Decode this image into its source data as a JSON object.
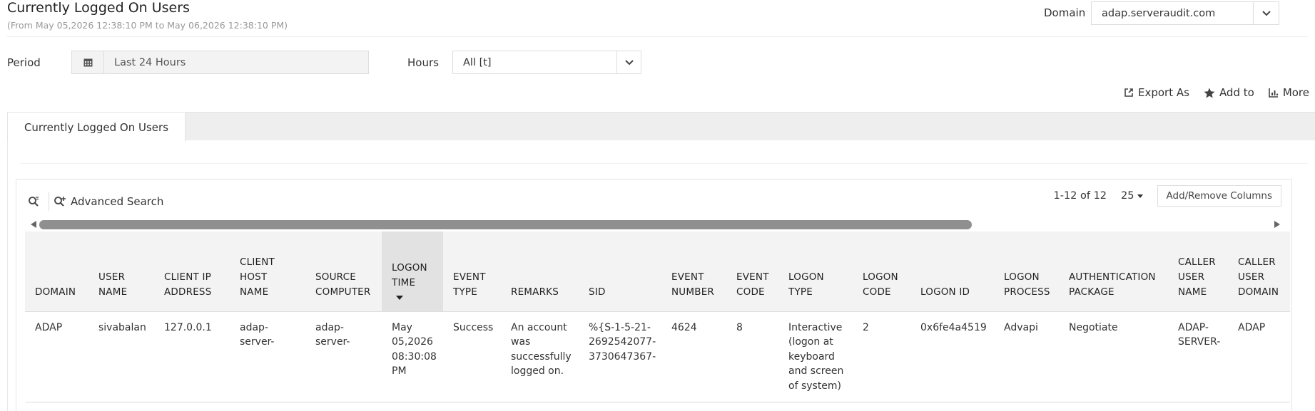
{
  "header": {
    "title": "Currently Logged On Users",
    "date_range": "(From May 05,2026 12:38:10 PM to May 06,2026 12:38:10 PM)",
    "domain_label": "Domain",
    "domain_value": "adap.serveraudit.com"
  },
  "filters": {
    "period_label": "Period",
    "period_value": "Last 24 Hours",
    "hours_label": "Hours",
    "hours_value": "All [t]"
  },
  "actions": {
    "export_label": "Export As",
    "add_label": "Add to",
    "more_label": "More"
  },
  "tabs": [
    {
      "label": "Currently Logged On Users"
    }
  ],
  "table_toolbar": {
    "advanced_search_label": "Advanced Search",
    "range_text": "1-12 of 12",
    "per_page": "25",
    "add_remove_label": "Add/Remove Columns"
  },
  "columns": [
    {
      "lines": [
        "DOMAIN"
      ]
    },
    {
      "lines": [
        "USER",
        "NAME"
      ]
    },
    {
      "lines": [
        "CLIENT IP",
        "ADDRESS"
      ]
    },
    {
      "lines": [
        "CLIENT",
        "HOST",
        "NAME"
      ]
    },
    {
      "lines": [
        "SOURCE",
        "COMPUTER"
      ]
    },
    {
      "lines": [
        "LOGON",
        "TIME"
      ]
    },
    {
      "lines": [
        "EVENT",
        "TYPE"
      ]
    },
    {
      "lines": [
        "REMARKS"
      ]
    },
    {
      "lines": [
        "SID"
      ]
    },
    {
      "lines": [
        "EVENT",
        "NUMBER"
      ]
    },
    {
      "lines": [
        "EVENT",
        "CODE"
      ]
    },
    {
      "lines": [
        "LOGON",
        "TYPE"
      ]
    },
    {
      "lines": [
        "LOGON",
        "CODE"
      ]
    },
    {
      "lines": [
        "LOGON ID"
      ]
    },
    {
      "lines": [
        "LOGON",
        "PROCESS"
      ]
    },
    {
      "lines": [
        "AUTHENTICATION",
        "PACKAGE"
      ]
    },
    {
      "lines": [
        "CALLER",
        "USER",
        "NAME"
      ]
    },
    {
      "lines": [
        "CALLER",
        "USER",
        "DOMAIN"
      ]
    }
  ],
  "rows": [
    {
      "cells": [
        [
          "ADAP"
        ],
        [
          "sivabalan"
        ],
        [
          "127.0.0.1"
        ],
        [
          "adap-",
          "server-"
        ],
        [
          "adap-",
          "server-"
        ],
        [
          "May",
          "05,2026",
          "08:30:08",
          "PM"
        ],
        [
          "Success"
        ],
        [
          "An account",
          "was",
          "successfully",
          "logged on."
        ],
        [
          "%{S-1-5-21-",
          "2692542077-",
          "3730647367-"
        ],
        [
          "4624"
        ],
        [
          "8"
        ],
        [
          "Interactive",
          "(logon at",
          "keyboard",
          "and screen",
          "of system)"
        ],
        [
          "2"
        ],
        [
          "0x6fe4a4519"
        ],
        [
          "Advapi"
        ],
        [
          "Negotiate"
        ],
        [
          "ADAP-",
          "SERVER-"
        ],
        [
          "ADAP"
        ]
      ]
    }
  ],
  "sorted_column": 5,
  "icons": {
    "domain_chevron": "chevron-down-icon",
    "calendar": "calendar-icon",
    "export": "export-icon",
    "star": "star-icon",
    "more": "more-icon",
    "quick_search": "quick-search-icon",
    "advanced_search": "advanced-search-icon"
  },
  "colors": {
    "scroll_thumb": "#8f8f8f",
    "header_bg": "#f3f3f3",
    "sorted_header_bg": "#e2e2e2"
  }
}
